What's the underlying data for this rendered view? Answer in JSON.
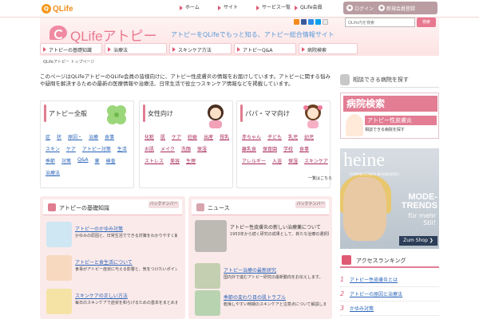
{
  "brand": {
    "logo_text": "QLife"
  },
  "top_links": [
    "ホーム",
    "サイト",
    "サービス一覧",
    "QLife会員"
  ],
  "account": {
    "login": "ログイン",
    "register": "新規会員登録"
  },
  "header": {
    "title": "QLifeアトピー",
    "tagline": "アトピーをQLifeでもっと知る、アトピー総合情報サイト",
    "search_placeholder": "QLife内を検索",
    "search_button": "検索"
  },
  "social_colors": [
    "#f58a1e",
    "#3b5998",
    "#2d8de8",
    "#00a0e9",
    "#e8e8e8"
  ],
  "nav": [
    "アトピーの基礎知識",
    "治療法",
    "スキンケア方法",
    "アトピーQ&A",
    "病院検索"
  ],
  "breadcrumb": "QLifeアトピー トップページ",
  "intro": "このページはQLifeアトピーのQLife会員の皆様向けに、アトピー性皮膚炎の情報をお届けしています。アトピーに関する悩みや疑問を解決するための最新の医療情報や治療法、日常生活で役立つスキンケア情報などを掲載しています。",
  "categories": [
    {
      "title": "アトピー全般",
      "links": [
        "症",
        "状",
        "原因・",
        "アトピー対策",
        "治療",
        "食事",
        "スキン",
        "ケア",
        "生活",
        "季節",
        "対策",
        "Q&A",
        "薬",
        "検査",
        "治療法"
      ]
    },
    {
      "title": "女性向け",
      "links": [
        "化粧",
        "肌",
        "ケア",
        "妊娠",
        "出産",
        "授乳",
        "お肌",
        "メイク",
        "洗顔",
        "保湿",
        "ストレス",
        "美容",
        "生理"
      ]
    },
    {
      "title": "パパ・ママ向け",
      "links": [
        "赤ちゃん",
        "子ども",
        "乳児",
        "幼児",
        "離乳食",
        "保育園",
        "学校",
        "食事",
        "アレルギー",
        "入浴",
        "保湿",
        "スキンケア"
      ]
    }
  ],
  "more_link": "一覧はこちら",
  "sections": [
    {
      "title": "アトピーの基礎知識",
      "backnumber": "バックナンバー",
      "entries": [
        {
          "title": "アトピーのかゆみ対策",
          "desc": "かゆみの原因と、日常生活でできる対策をわかりやすく解説します。"
        },
        {
          "title": "アトピーと食生活について",
          "desc": "食事がアトピー症状に与える影響と、気をつけたいポイントを紹介。"
        },
        {
          "title": "スキンケアの正しい方法",
          "desc": "毎日のスキンケアで症状を和らげるための基本をまとめました。"
        }
      ]
    },
    {
      "title": "ニュース",
      "backnumber": "バックナンバー",
      "entries": [
        {
          "title": "アトピー性皮膚炎の新しい治療薬について",
          "desc": "1953年から続く研究の成果として、新たな治療の選択肢が注目されています。"
        },
        {
          "title": "アトピー治療の最新研究",
          "desc": "国内外で進むアトピー研究の最新動向をお伝えします。"
        },
        {
          "title": "季節の変わり目の肌トラブル",
          "desc": "乾燥しやすい時期のスキンケアと注意点について解説します。"
        }
      ]
    }
  ],
  "right": {
    "search_label": "相談できる病院を探す",
    "banner_title": "病院検索",
    "banner_sub": "アトピー性皮膚炎",
    "banner_note": "相談できる病院を探す",
    "ad": {
      "brand": "heine",
      "brand_sub": "SOMMER ETWAS BESONDERES",
      "headline": "MODE-TRENDS",
      "sub": "für mehr Stil!",
      "cta": "Zum Shop ❯"
    },
    "ranking_title": "アクセスランキング",
    "ranking": [
      {
        "num": "1",
        "title": "アトピー性皮膚炎とは"
      },
      {
        "num": "2",
        "title": "アトピーの原因と治療法"
      },
      {
        "num": "3",
        "title": "かゆみ対策"
      }
    ]
  }
}
